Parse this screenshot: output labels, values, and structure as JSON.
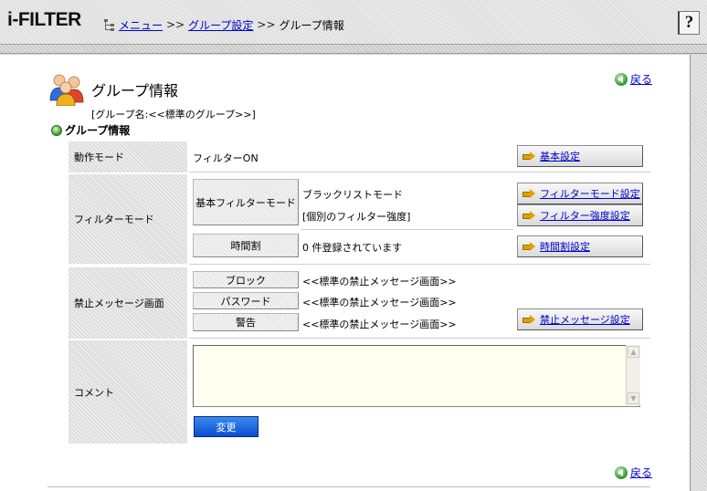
{
  "app": {
    "logo": "i-FILTER",
    "help_label": "?"
  },
  "breadcrumb": {
    "menu": "メニュー",
    "group_settings": "グループ設定",
    "current": "グループ情報",
    "separator": ">>"
  },
  "page": {
    "title": "グループ情報",
    "group_name": "[グループ名:<<標準のグループ>>]",
    "section_heading": "グループ情報",
    "back_label": "戻る"
  },
  "rows": {
    "mode": {
      "label": "動作モード",
      "value": "フィルターON",
      "button": "基本設定"
    },
    "filter": {
      "label": "フィルターモード",
      "basic_label": "基本フィルターモード",
      "basic_value": "ブラックリストモード",
      "strength_value": "[個別のフィルター強度]",
      "mode_button": "フィルターモード設定",
      "strength_button": "フィルター強度設定",
      "time_label": "時間割",
      "time_value": "0 件登録されています",
      "time_button": "時間割設定"
    },
    "block": {
      "label": "禁止メッセージ画面",
      "items": [
        {
          "label": "ブロック",
          "value": "<<標準の禁止メッセージ画面>>"
        },
        {
          "label": "パスワード",
          "value": "<<標準の禁止メッセージ画面>>"
        },
        {
          "label": "警告",
          "value": "<<標準の禁止メッセージ画面>>"
        }
      ],
      "button": "禁止メッセージ設定"
    },
    "comment": {
      "label": "コメント",
      "value": "",
      "submit": "変更"
    }
  },
  "colors": {
    "link": "#0000cc",
    "submit": "#0a4ed0",
    "comment_bg": "#fffff0",
    "ok_green": "#2e8f2e"
  }
}
